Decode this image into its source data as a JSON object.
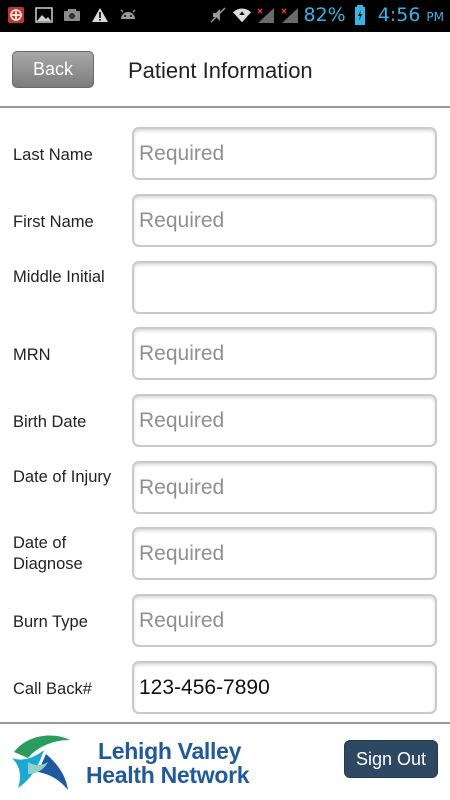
{
  "status_bar": {
    "icons_left": [
      "app-icon",
      "image-icon",
      "camera-icon",
      "warning-icon",
      "android-icon"
    ],
    "icons_right": [
      "mute-icon",
      "wifi-icon",
      "signal-icon",
      "signal-icon"
    ],
    "battery_percent": "82%",
    "time": "4:56",
    "ampm": "PM"
  },
  "header": {
    "back_label": "Back",
    "title": "Patient Information"
  },
  "form": {
    "fields": [
      {
        "label": "Last Name",
        "placeholder": "Required",
        "value": ""
      },
      {
        "label": "First Name",
        "placeholder": "Required",
        "value": ""
      },
      {
        "label": "Middle Initial",
        "placeholder": "",
        "value": ""
      },
      {
        "label": "MRN",
        "placeholder": "Required",
        "value": ""
      },
      {
        "label": "Birth Date",
        "placeholder": "Required",
        "value": ""
      },
      {
        "label": "Date of Injury",
        "placeholder": "Required",
        "value": ""
      },
      {
        "label": "Date of Diagnose",
        "placeholder": "Required",
        "value": ""
      },
      {
        "label": "Burn Type",
        "placeholder": "Required",
        "value": ""
      },
      {
        "label": "Call Back#",
        "placeholder": "",
        "value": "123-456-7890"
      }
    ]
  },
  "footer": {
    "org_line1": "Lehigh Valley",
    "org_line2": "Health Network",
    "signout_label": "Sign Out"
  },
  "colors": {
    "status_accent": "#33b5e5",
    "brand_blue": "#1f5a9f",
    "logo_green": "#2a9d5c",
    "logo_cyan": "#1aa9d6",
    "signout_bg": "#2f4862"
  }
}
